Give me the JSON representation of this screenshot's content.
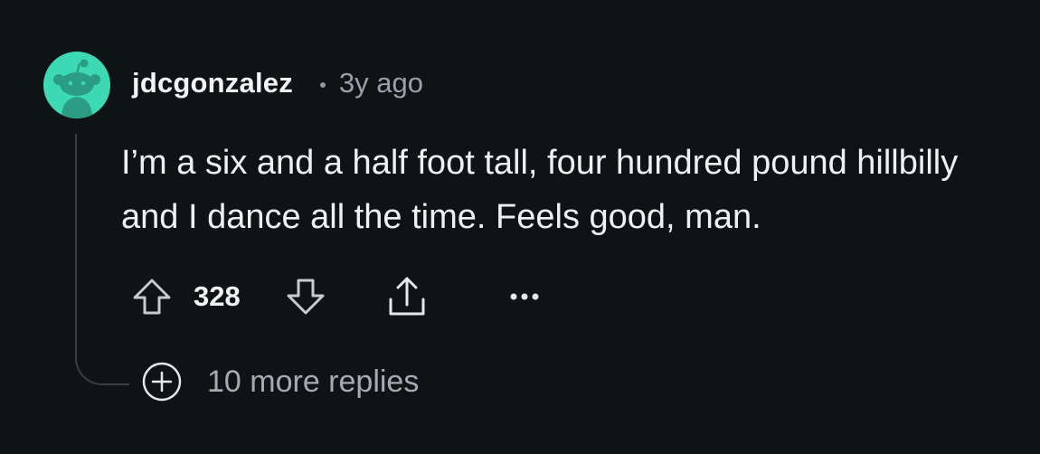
{
  "comment": {
    "author": "jdcgonzalez",
    "timestamp": "3y ago",
    "body": "I’m a six and a half foot tall, four hundred pound hillbilly and I dance all the time. Feels good, man.",
    "score": "328",
    "more_replies_label": "10 more replies"
  },
  "icons": {
    "avatar": "reddit-snoo-avatar",
    "upvote": "arrow-up-outline-icon",
    "downvote": "arrow-down-outline-icon",
    "share": "share-upload-icon",
    "more": "ellipsis-icon",
    "expand": "plus-circle-icon"
  },
  "colors": {
    "background": "#0e1416",
    "avatar_bg": "#3dd9b4",
    "text_primary": "#f2f4f5",
    "text_secondary": "#97a2a7",
    "thread_line": "#353f44"
  }
}
